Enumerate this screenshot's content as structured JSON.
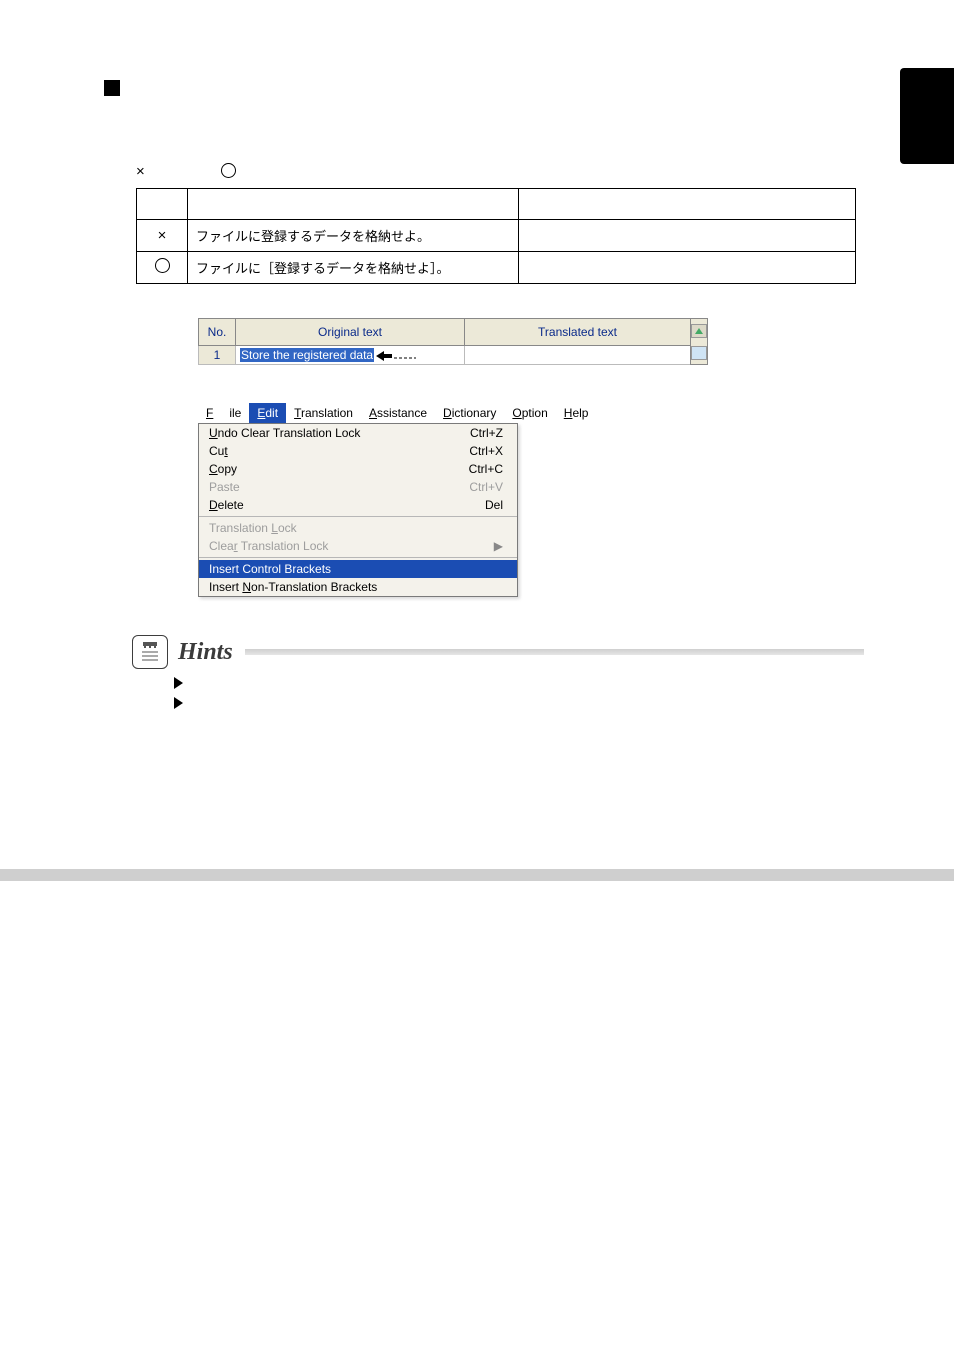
{
  "legend": {
    "x_symbol": "×",
    "o_open": "",
    "between": ""
  },
  "example_table": {
    "rows": [
      {
        "mark": "×",
        "jp": "ファイルに登録するデータを格納せよ。",
        "right": ""
      },
      {
        "mark": "○",
        "jp": "ファイルに［登録するデータを格納せよ］。",
        "right": ""
      }
    ]
  },
  "grid": {
    "headers": {
      "no": "No.",
      "orig": "Original text",
      "trans": "Translated text"
    },
    "row": {
      "no": "1",
      "orig_selected": "Store the registered data",
      "orig_rest": ""
    }
  },
  "menubar": {
    "file": "File",
    "edit": "Edit",
    "translation": "Translation",
    "assistance": "Assistance",
    "dictionary": "Dictionary",
    "option": "Option",
    "help": "Help"
  },
  "menu": {
    "undo": "Undo Clear Translation Lock",
    "undo_k": "Ctrl+Z",
    "cut": "Cut",
    "cut_k": "Ctrl+X",
    "copy": "Copy",
    "copy_k": "Ctrl+C",
    "paste": "Paste",
    "paste_k": "Ctrl+V",
    "delete": "Delete",
    "delete_k": "Del",
    "tlock": "Translation Lock",
    "clear": "Clear Translation Lock",
    "insert_ctrl": "Insert Control Brackets",
    "insert_non": "Insert Non-Translation Brackets"
  },
  "hints": {
    "title": "Hints"
  }
}
